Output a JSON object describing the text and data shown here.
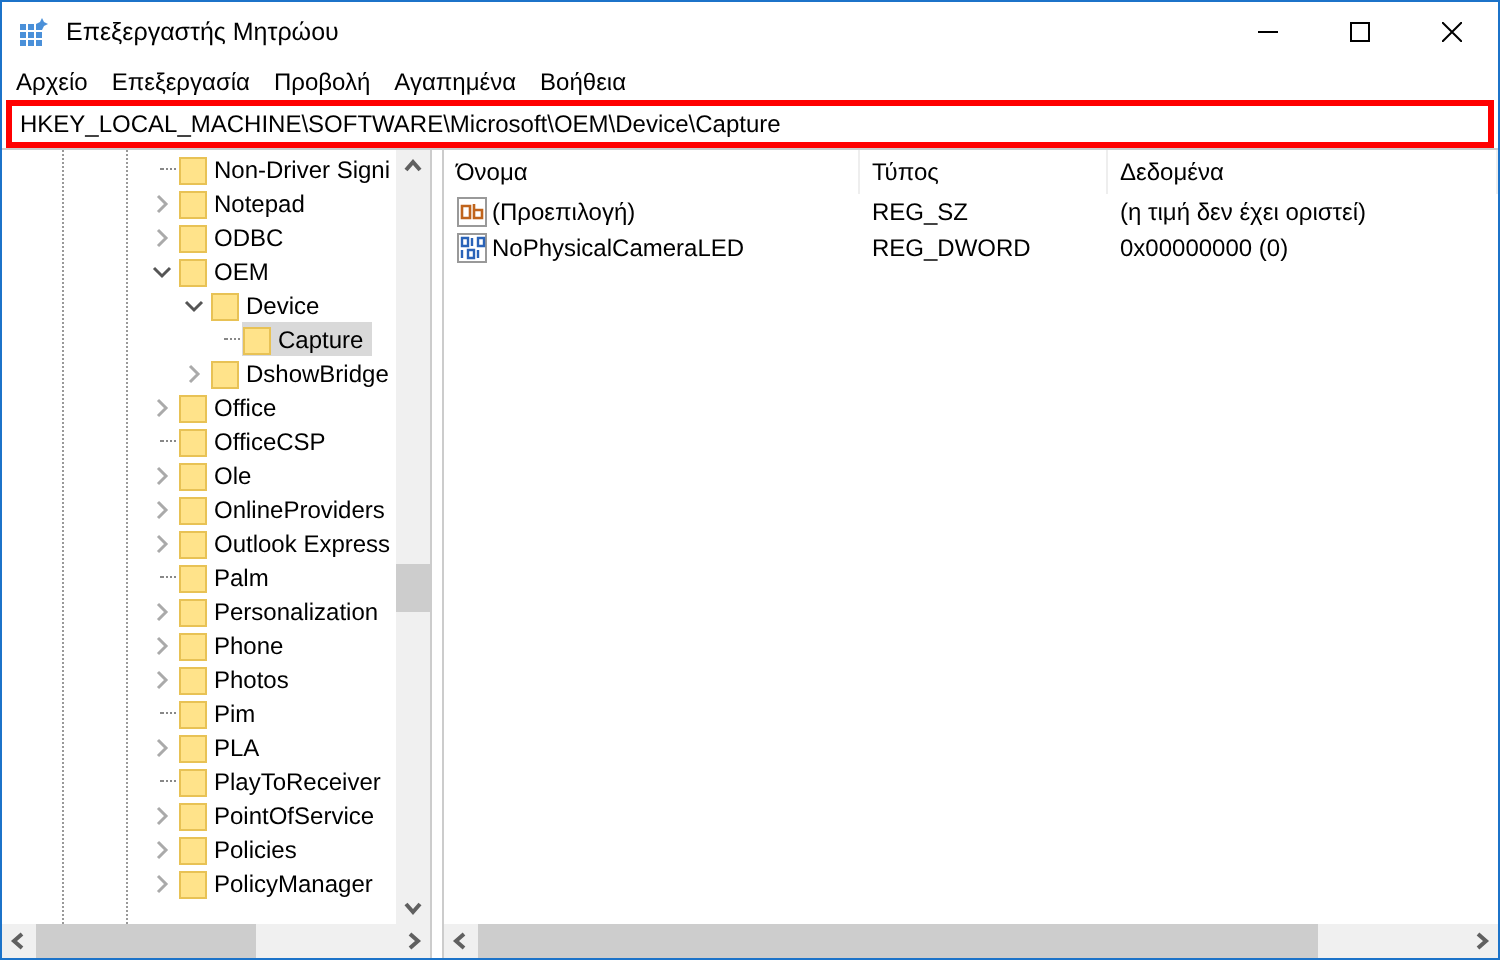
{
  "window": {
    "title": "Επεξεργαστής Μητρώου"
  },
  "menu": [
    "Αρχείο",
    "Επεξεργασία",
    "Προβολή",
    "Αγαπημένα",
    "Βοήθεια"
  ],
  "address": {
    "value": "HKEY_LOCAL_MACHINE\\SOFTWARE\\Microsoft\\OEM\\Device\\Capture",
    "highlighted": true
  },
  "tree": [
    {
      "label": "Non-Driver Signi",
      "kind": "leaf",
      "selected": false
    },
    {
      "label": "Notepad",
      "kind": "branch",
      "expanded": false,
      "selected": false
    },
    {
      "label": "ODBC",
      "kind": "branch",
      "expanded": false,
      "selected": false
    },
    {
      "label": "OEM",
      "kind": "branch",
      "expanded": true,
      "selected": false,
      "children": [
        {
          "label": "Device",
          "kind": "branch",
          "expanded": true,
          "selected": false,
          "children": [
            {
              "label": "Capture",
              "kind": "leaf",
              "selected": true
            }
          ]
        },
        {
          "label": "DshowBridge",
          "kind": "branch",
          "expanded": false,
          "selected": false
        }
      ]
    },
    {
      "label": "Office",
      "kind": "branch",
      "expanded": false,
      "selected": false
    },
    {
      "label": "OfficeCSP",
      "kind": "leaf",
      "selected": false
    },
    {
      "label": "Ole",
      "kind": "branch",
      "expanded": false,
      "selected": false
    },
    {
      "label": "OnlineProviders",
      "kind": "branch",
      "expanded": false,
      "selected": false
    },
    {
      "label": "Outlook Express",
      "kind": "branch",
      "expanded": false,
      "selected": false
    },
    {
      "label": "Palm",
      "kind": "leaf",
      "selected": false
    },
    {
      "label": "Personalization",
      "kind": "branch",
      "expanded": false,
      "selected": false
    },
    {
      "label": "Phone",
      "kind": "branch",
      "expanded": false,
      "selected": false
    },
    {
      "label": "Photos",
      "kind": "branch",
      "expanded": false,
      "selected": false
    },
    {
      "label": "Pim",
      "kind": "leaf",
      "selected": false
    },
    {
      "label": "PLA",
      "kind": "branch",
      "expanded": false,
      "selected": false
    },
    {
      "label": "PlayToReceiver",
      "kind": "leaf",
      "selected": false
    },
    {
      "label": "PointOfService",
      "kind": "branch",
      "expanded": false,
      "selected": false
    },
    {
      "label": "Policies",
      "kind": "branch",
      "expanded": false,
      "selected": false
    },
    {
      "label": "PolicyManager",
      "kind": "branch",
      "expanded": false,
      "selected": false
    }
  ],
  "table": {
    "columns": [
      "Όνομα",
      "Τύπος",
      "Δεδομένα"
    ],
    "rows": [
      {
        "kind": "string",
        "name": "(Προεπιλογή)",
        "type": "REG_SZ",
        "data": "(η τιμή δεν έχει οριστεί)"
      },
      {
        "kind": "binary",
        "name": "NoPhysicalCameraLED",
        "type": "REG_DWORD",
        "data": "0x00000000 (0)"
      }
    ]
  }
}
